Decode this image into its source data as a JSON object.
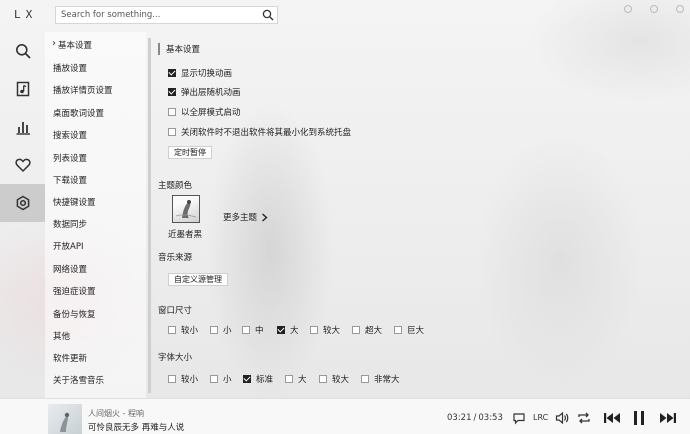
{
  "app": {
    "logo": "LX"
  },
  "search": {
    "placeholder": "Search for something..."
  },
  "nav": [
    {
      "name": "search",
      "icon": "search-icon"
    },
    {
      "name": "songlist",
      "icon": "music-file-icon"
    },
    {
      "name": "leaderboard",
      "icon": "bar-chart-icon"
    },
    {
      "name": "favorites",
      "icon": "heart-icon"
    },
    {
      "name": "settings",
      "icon": "gear-icon",
      "active": true
    }
  ],
  "settings_menu": {
    "items": [
      "基本设置",
      "播放设置",
      "播放详情页设置",
      "桌面歌词设置",
      "搜索设置",
      "列表设置",
      "下载设置",
      "快捷键设置",
      "数据同步",
      "开放API",
      "网络设置",
      "强迫症设置",
      "备份与恢复",
      "其他",
      "软件更新",
      "关于洛雪音乐"
    ],
    "active_index": 0
  },
  "basic": {
    "title": "基本设置",
    "options": [
      {
        "label": "显示切换动画",
        "checked": true
      },
      {
        "label": "弹出层随机动画",
        "checked": true
      },
      {
        "label": "以全屏模式启动",
        "checked": false
      },
      {
        "label": "关闭软件时不退出软件将其最小化到系统托盘",
        "checked": false
      }
    ],
    "timer_button": "定时暂停"
  },
  "theme": {
    "title": "主题颜色",
    "current_name": "近墨者黑",
    "more_label": "更多主题"
  },
  "music_source": {
    "title": "音乐来源",
    "button": "自定义源管理"
  },
  "window_size": {
    "title": "窗口尺寸",
    "options": [
      {
        "label": "较小",
        "checked": false
      },
      {
        "label": "小",
        "checked": false
      },
      {
        "label": "中",
        "checked": false
      },
      {
        "label": "大",
        "checked": true
      },
      {
        "label": "较大",
        "checked": false
      },
      {
        "label": "超大",
        "checked": false
      },
      {
        "label": "巨大",
        "checked": false
      }
    ]
  },
  "font_size": {
    "title": "字体大小",
    "options": [
      {
        "label": "较小",
        "checked": false
      },
      {
        "label": "小",
        "checked": false
      },
      {
        "label": "标准",
        "checked": true
      },
      {
        "label": "大",
        "checked": false
      },
      {
        "label": "较大",
        "checked": false
      },
      {
        "label": "非常大",
        "checked": false
      }
    ]
  },
  "player": {
    "song": "人间烟火 - 程响",
    "lyric": "可怜良辰无多 再难与人说",
    "current_time": "03:21",
    "separator": "/",
    "total_time": "03:53",
    "lrc_label": "LRC"
  },
  "colors": {
    "accent": "#222222",
    "active_nav": "#8c8c8c"
  }
}
